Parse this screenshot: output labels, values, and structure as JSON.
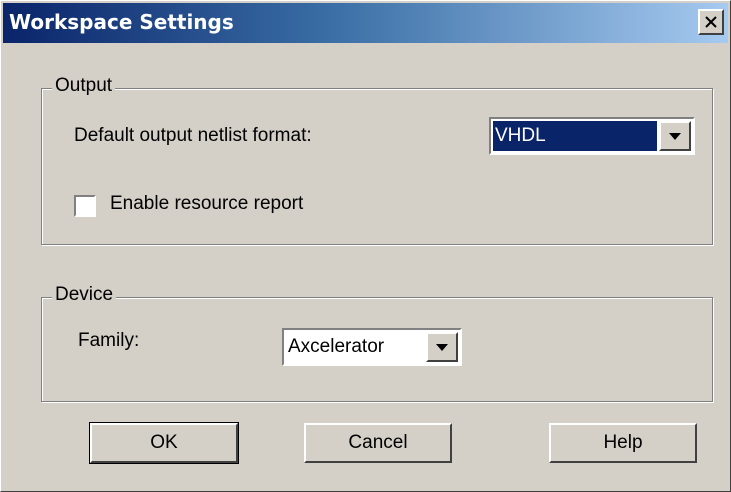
{
  "window": {
    "title": "Workspace Settings",
    "close_glyph": "✕"
  },
  "output": {
    "legend": "Output",
    "netlist_label": "Default output netlist format:",
    "netlist_value": "VHDL",
    "resource_report_label": "Enable resource report",
    "resource_report_checked": false
  },
  "device": {
    "legend": "Device",
    "family_label": "Family:",
    "family_value": "Axcelerator"
  },
  "buttons": {
    "ok": "OK",
    "cancel": "Cancel",
    "help": "Help"
  }
}
